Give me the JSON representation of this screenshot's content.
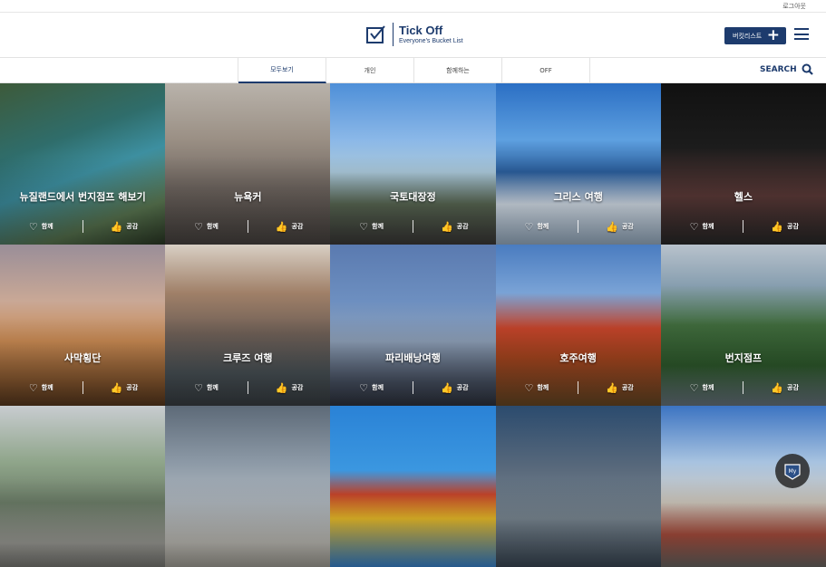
{
  "topbar": {
    "logout": "로그아웃"
  },
  "logo": {
    "title": "Tick Off",
    "subtitle": "Everyone's Bucket List"
  },
  "header": {
    "bucket_button": "버킷리스트",
    "bucket_plus": "+"
  },
  "tabs": [
    {
      "label": "모두보기"
    },
    {
      "label": "개인"
    },
    {
      "label": "함께하는"
    },
    {
      "label": "OFF"
    }
  ],
  "search": {
    "label": "SEARCH"
  },
  "actions": {
    "together": "함께",
    "empathy": "공감"
  },
  "tiles": [
    {
      "title": "뉴질랜드에서 번지점프 해보기",
      "bg": "linear-gradient(160deg,#3d5a3a 0%,#2f6d6b 35%,#3d8fa0 55%,#5d7b54 80%,#2c3a26 100%)"
    },
    {
      "title": "뉴욕커",
      "bg": "linear-gradient(180deg,#b9b3ab 0%,#9a8f84 35%,#6f6660 65%,#4a4542 100%)"
    },
    {
      "title": "국토대장정",
      "bg": "linear-gradient(180deg,#4e8fd8 0%,#8bb8e8 35%,#a9c7d9 55%,#5b6a55 75%,#3d3b3a 100%)"
    },
    {
      "title": "그리스 여행",
      "bg": "linear-gradient(180deg,#2b6fc4 0%,#5ea0e0 35%,#2a5d9a 55%,#d9e3ee 75%,#9fb6cc 100%)"
    },
    {
      "title": "헬스",
      "bg": "linear-gradient(180deg,#111 0%,#1c1c1c 40%,#5c3a38 70%,#2a2a2a 100%)"
    },
    {
      "title": "사막횡단",
      "bg": "linear-gradient(180deg,#9a8e98 0%,#c9a896 35%,#c98a53 60%,#8a5a30 85%,#5b3a1f 100%)"
    },
    {
      "title": "크루즈 여행",
      "bg": "linear-gradient(180deg,#d8cfc4 0%,#a08068 30%,#6e5f56 55%,#4a5358 80%,#3a4045 100%)"
    },
    {
      "title": "파리배낭여행",
      "bg": "linear-gradient(180deg,#5a7ab0 0%,#6d8fc0 35%,#8ea0b8 60%,#4a5466 85%,#2f3440 100%)"
    },
    {
      "title": "호주여행",
      "bg": "linear-gradient(180deg,#4a7cc0 0%,#7aa3d6 30%,#c2432a 52%,#a8461f 70%,#6b4a25 100%)"
    },
    {
      "title": "번지점프",
      "bg": "linear-gradient(180deg,#b8c2cc 0%,#889fb0 25%,#3f6a3c 50%,#2e5a2c 75%,#6d7a84 100%)"
    },
    {
      "title": "",
      "bg": "linear-gradient(180deg,#c8ccd0 0%,#8fa58a 35%,#6c7d68 60%,#a6a6a0 85%,#7d7d78 100%)"
    },
    {
      "title": "",
      "bg": "linear-gradient(180deg,#5d6a78 0%,#8c99a6 35%,#b0b8bf 60%,#c9c7c0 85%,#a8a59c 100%)"
    },
    {
      "title": "",
      "bg": "linear-gradient(180deg,#2a82d6 0%,#3b97e0 40%,#c7452b 55%,#f0c12a 70%,#3a8ad8 100%)"
    },
    {
      "title": "",
      "bg": "linear-gradient(180deg,#2b4b6e 0%,#5a6a7c 40%,#7d8b96 70%,#3c4a58 100%)"
    },
    {
      "title": "",
      "bg": "linear-gradient(180deg,#3c74c2 0%,#a8c3e0 35%,#cfc8bd 60%,#b0503f 80%,#6d6a66 100%)"
    }
  ],
  "my_badge": {
    "label": "My"
  }
}
